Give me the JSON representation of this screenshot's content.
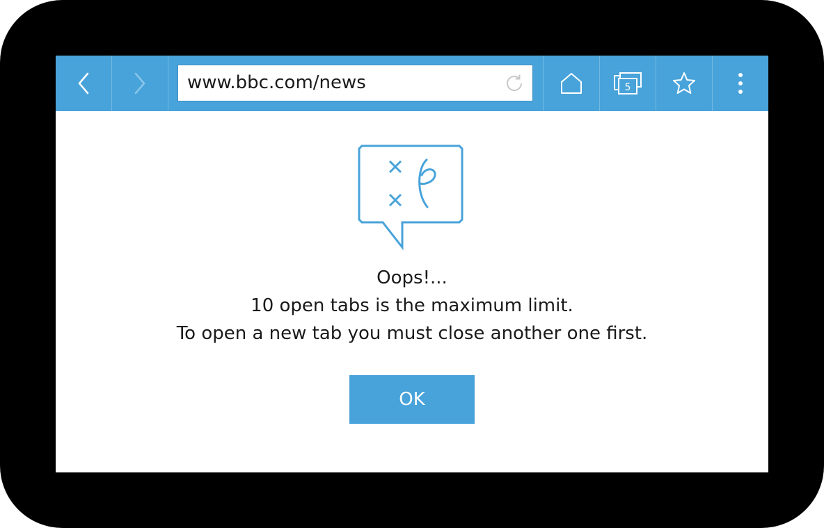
{
  "browser": {
    "url": "www.bbc.com/news",
    "tab_count": "5",
    "colors": {
      "toolbar": "#48a3da",
      "accent": "#48a3da"
    },
    "icons": {
      "back": "chevron-left-icon",
      "forward": "chevron-right-icon",
      "reload": "reload-icon",
      "home": "home-icon",
      "tabs": "tabs-icon",
      "bookmark": "star-icon",
      "menu": "more-vertical-icon"
    }
  },
  "dialog": {
    "title": "Oops!...",
    "line1": "10 open tabs is the maximum limit.",
    "line2": "To open a new tab you must close another one first.",
    "ok_label": "OK",
    "illustration": "sad-face-speech-bubble-icon"
  }
}
